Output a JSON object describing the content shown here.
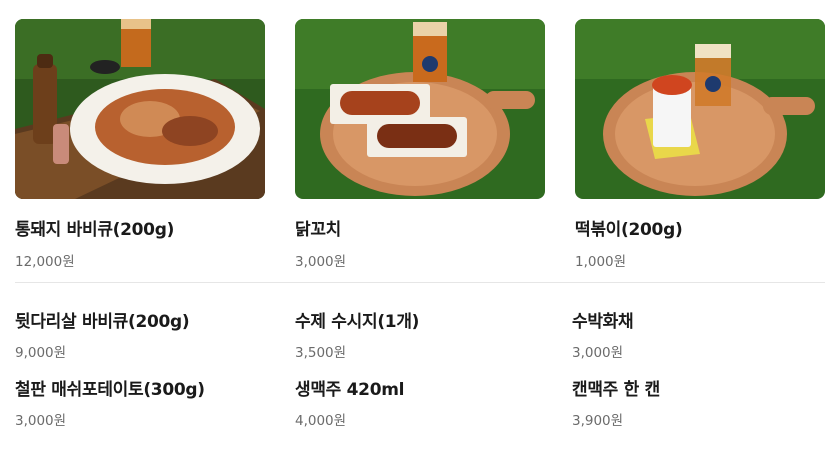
{
  "featured": [
    {
      "name": "통돼지 바비큐(200g)",
      "price": "12,000원",
      "icon": "bbq-pork-photo"
    },
    {
      "name": "닭꼬치",
      "price": "3,000원",
      "icon": "chicken-skewer-photo"
    },
    {
      "name": "떡볶이(200g)",
      "price": "1,000원",
      "icon": "tteokbokki-photo"
    }
  ],
  "menu": [
    {
      "name": "뒷다리살 바비큐(200g)",
      "price": "9,000원"
    },
    {
      "name": "수제 수시지(1개)",
      "price": "3,500원"
    },
    {
      "name": "수박화채",
      "price": "3,000원"
    },
    {
      "name": "철판 매쉬포테이토(300g)",
      "price": "3,000원"
    },
    {
      "name": "생맥주 420ml",
      "price": "4,000원"
    },
    {
      "name": "캔맥주 한 캔",
      "price": "3,900원"
    }
  ],
  "colors": {
    "grass": "#2f5a1c",
    "board": "#b9774a",
    "text": "#1a1a1a",
    "price": "#6b6b6b"
  }
}
